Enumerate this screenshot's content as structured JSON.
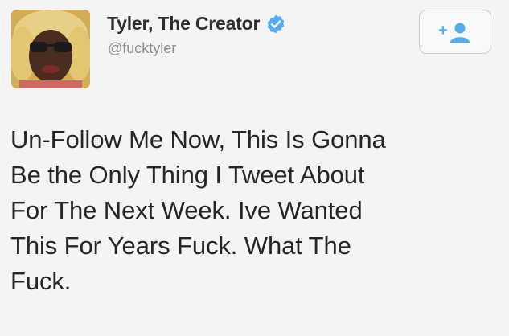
{
  "user": {
    "display_name": "Tyler, The Creator",
    "handle": "@fucktyler",
    "verified": true
  },
  "icons": {
    "verified_badge": "verified-badge-icon",
    "follow_button": "follow-add-user-icon",
    "follow_plus": "+"
  },
  "tweet": {
    "lines": [
      "Un-Follow Me Now, This Is Gonna",
      "Be the Only Thing I Tweet About",
      "For The Next Week. Ive Wanted",
      "This For Years Fuck. What The",
      "Fuck."
    ]
  },
  "colors": {
    "verified_blue": "#55acee",
    "follow_icon_blue": "#55acee",
    "name_text": "#292f33",
    "handle_text": "#8a8f94"
  }
}
